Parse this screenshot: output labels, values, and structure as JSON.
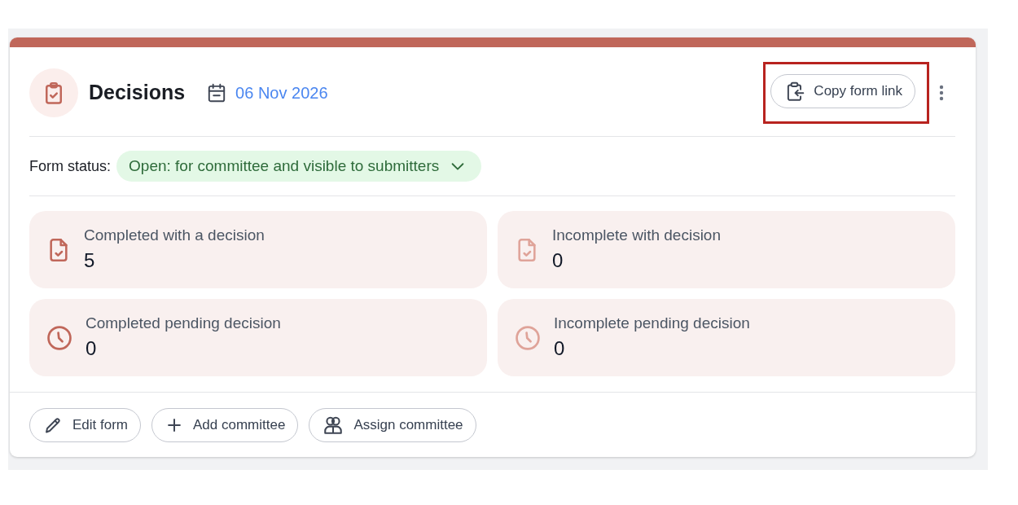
{
  "header": {
    "title": "Decisions",
    "date": "06 Nov 2026",
    "copy_button": {
      "label": "Copy form link",
      "highlighted": true
    }
  },
  "form_status": {
    "label": "Form status:",
    "value": "Open: for committee and visible to submitters"
  },
  "stats": [
    {
      "kind": "decision",
      "label": "Completed with a decision",
      "value": "5",
      "muted": false
    },
    {
      "kind": "decision",
      "label": "Incomplete with decision",
      "value": "0",
      "muted": true
    },
    {
      "kind": "pending",
      "label": "Completed pending decision",
      "value": "0",
      "muted": false
    },
    {
      "kind": "pending",
      "label": "Incomplete pending decision",
      "value": "0",
      "muted": true
    }
  ],
  "actions": [
    {
      "kind": "edit",
      "label": "Edit form"
    },
    {
      "kind": "add",
      "label": "Add committee"
    },
    {
      "kind": "assign",
      "label": "Assign committee"
    }
  ]
}
